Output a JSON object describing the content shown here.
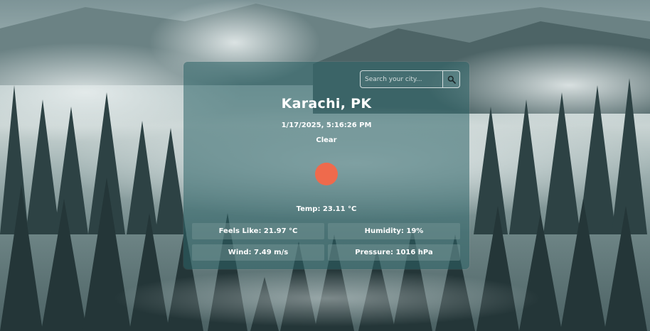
{
  "search": {
    "placeholder": "Search your city...",
    "button_icon": "search-icon"
  },
  "weather": {
    "city": "Karachi, PK",
    "datetime": "1/17/2025, 5:16:26 PM",
    "condition": "Clear",
    "icon": "sun-icon",
    "icon_color": "#ef6a4c",
    "temp": "Temp: 23.11 °C"
  },
  "stats": {
    "feels_like": "Feels Like: 21.97 °C",
    "humidity": "Humidity: 19%",
    "wind": "Wind: 7.49 m/s",
    "pressure": "Pressure: 1016 hPa"
  }
}
